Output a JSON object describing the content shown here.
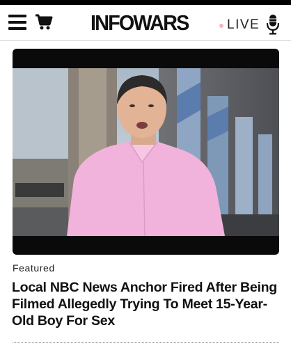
{
  "header": {
    "logo_text": "INFOWARS",
    "live_label": "LIVE",
    "icons": [
      "hamburger-menu-icon",
      "cart-icon",
      "microphone-icon"
    ],
    "live_dot_color": "#f2b8bd"
  },
  "article": {
    "category": "Featured",
    "headline": "Local NBC News Anchor Fired After Being Filmed Allegedly Trying To Meet 15-Year-Old Boy For Sex"
  }
}
